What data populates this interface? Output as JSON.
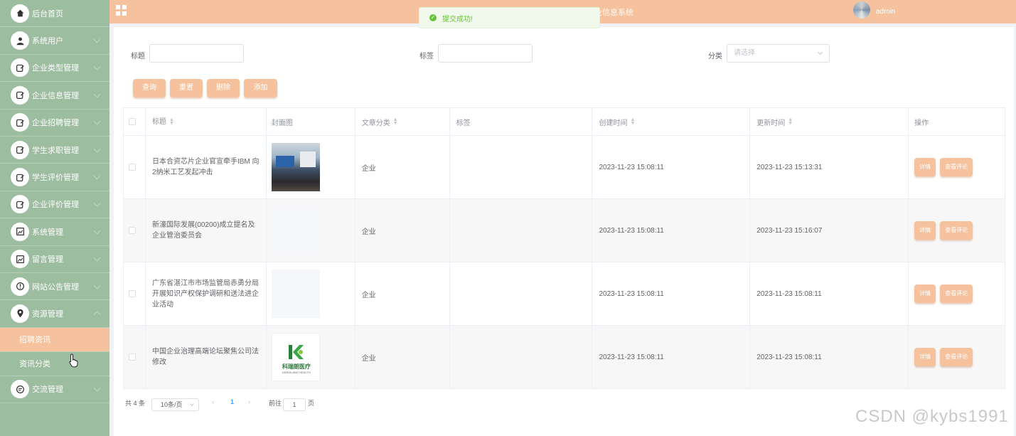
{
  "header": {
    "title": "基于微信小程序的大学生就业信息系统",
    "user": "admin"
  },
  "toast": {
    "message": "提交成功!"
  },
  "sidebar": {
    "items": [
      {
        "label": "后台首页",
        "icon": "home-icon"
      },
      {
        "label": "系统用户",
        "icon": "user-icon"
      },
      {
        "label": "企业类型管理",
        "icon": "edit-icon"
      },
      {
        "label": "企业信息管理",
        "icon": "edit-icon"
      },
      {
        "label": "企业招聘管理",
        "icon": "edit-icon"
      },
      {
        "label": "学生求职管理",
        "icon": "edit-icon"
      },
      {
        "label": "学生评价管理",
        "icon": "edit-icon"
      },
      {
        "label": "企业评价管理",
        "icon": "edit-icon"
      },
      {
        "label": "系统管理",
        "icon": "image-icon"
      },
      {
        "label": "留言管理",
        "icon": "image-icon"
      },
      {
        "label": "网站公告管理",
        "icon": "info-icon"
      },
      {
        "label": "资源管理",
        "icon": "location-icon"
      },
      {
        "label": "交流管理",
        "icon": "chat-icon"
      }
    ],
    "sub_items": [
      {
        "label": "招聘资讯"
      },
      {
        "label": "资讯分类"
      }
    ]
  },
  "search": {
    "title_label": "标题",
    "tag_label": "标签",
    "category_label": "分类",
    "category_placeholder": "请选择"
  },
  "toolbar": {
    "query": "查询",
    "reset": "重置",
    "delete": "删除",
    "add": "添加"
  },
  "table": {
    "columns": [
      "",
      "标题",
      "封面图",
      "文章分类",
      "标签",
      "创建时间",
      "更新时间",
      "操作"
    ],
    "rows": [
      {
        "title": "日本合资芯片企业官宣牵手IBM 向2纳米工艺发起冲击",
        "category": "企业",
        "tag": "",
        "created": "2023-11-23 15:08:11",
        "updated": "2023-11-23 15:13:31",
        "cover": "photo"
      },
      {
        "title": "新濠国际发展(00200)成立提名及企业管治委员会",
        "category": "企业",
        "tag": "",
        "created": "2023-11-23 15:08:11",
        "updated": "2023-11-23 15:16:07",
        "cover": "blank"
      },
      {
        "title": "广东省湛江市市场监管局赤勇分局开展知识产权保护调研和送法进企业活动",
        "category": "企业",
        "tag": "",
        "created": "2023-11-23 15:08:11",
        "updated": "2023-11-23 15:08:11",
        "cover": "blank"
      },
      {
        "title": "中国企业治理高端论坛聚焦公司法修改",
        "category": "企业",
        "tag": "",
        "created": "2023-11-23 15:08:11",
        "updated": "2023-11-23 15:08:11",
        "cover": "logo"
      }
    ],
    "actions": {
      "detail": "详情",
      "comments": "查看评论"
    },
    "logo_text": "科瑞朗医疗",
    "logo_sub": "KERUILANG HEALTH"
  },
  "pagination": {
    "total": "共 4 条",
    "page_size": "10条/页",
    "current_page": "1",
    "goto_label": "前往",
    "goto_value": "1",
    "page_unit": "页"
  },
  "watermark": "CSDN @kybs1991",
  "colors": {
    "sidebar": "#9dbda0",
    "accent": "#f5c29d",
    "success": "#67c23a"
  }
}
